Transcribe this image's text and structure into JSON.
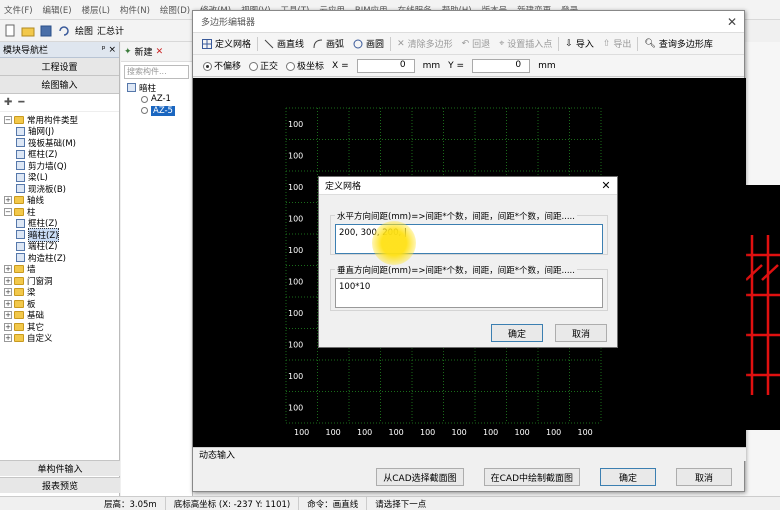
{
  "app": {
    "menu": [
      "文件(F)",
      "编辑(E)",
      "楼层(L)",
      "构件(N)",
      "绘图(D)",
      "修改(M)",
      "视图(V)",
      "工具(T)",
      "云应用",
      "BIM应用",
      "在线服务",
      "帮助(H)",
      "版本号",
      "新建变更",
      "登录"
    ],
    "toolbar": {
      "draw": "绘图",
      "summary": "汇总计"
    }
  },
  "left_panel": {
    "title": "模块导航栏",
    "pin": "ᵖ ×",
    "project_settings": "工程设置",
    "drawing_input": "绘图输入",
    "tree": [
      {
        "label": "常用构件类型",
        "level": 0,
        "type": "folder",
        "exp": "−"
      },
      {
        "label": "轴网(J)",
        "level": 1,
        "type": "leaf"
      },
      {
        "label": "筏板基础(M)",
        "level": 1,
        "type": "leaf"
      },
      {
        "label": "框柱(Z)",
        "level": 1,
        "type": "leaf"
      },
      {
        "label": "剪力墙(Q)",
        "level": 1,
        "type": "leaf"
      },
      {
        "label": "梁(L)",
        "level": 1,
        "type": "leaf"
      },
      {
        "label": "现浇板(B)",
        "level": 1,
        "type": "leaf"
      },
      {
        "label": "轴线",
        "level": 0,
        "type": "folder",
        "exp": "+"
      },
      {
        "label": "柱",
        "level": 0,
        "type": "folder",
        "exp": "−"
      },
      {
        "label": "框柱(Z)",
        "level": 1,
        "type": "leaf"
      },
      {
        "label": "暗柱(Z)",
        "level": 1,
        "type": "leaf",
        "selected": true
      },
      {
        "label": "端柱(Z)",
        "level": 1,
        "type": "leaf"
      },
      {
        "label": "构造柱(Z)",
        "level": 1,
        "type": "leaf"
      },
      {
        "label": "墙",
        "level": 0,
        "type": "folder",
        "exp": "+"
      },
      {
        "label": "门窗洞",
        "level": 0,
        "type": "folder",
        "exp": "+"
      },
      {
        "label": "梁",
        "level": 0,
        "type": "folder",
        "exp": "+"
      },
      {
        "label": "板",
        "level": 0,
        "type": "folder",
        "exp": "+"
      },
      {
        "label": "基础",
        "level": 0,
        "type": "folder",
        "exp": "+"
      },
      {
        "label": "其它",
        "level": 0,
        "type": "folder",
        "exp": "+"
      },
      {
        "label": "自定义",
        "level": 0,
        "type": "folder",
        "exp": "+"
      }
    ],
    "single_input": "单构件输入",
    "report_preview": "报表预览"
  },
  "component_panel": {
    "new": "新建",
    "search_placeholder": "搜索构件...",
    "root": "暗柱",
    "items": [
      "AZ-1",
      "AZ-5"
    ]
  },
  "status": {
    "floor_height": "层高：3.05m",
    "base_elev": "底标高坐标 (X: -237 Y: 1101)",
    "command": "命令：画直线",
    "prompt": "请选择下一点"
  },
  "poly_editor": {
    "title": "多边形编辑器",
    "toolbar": {
      "define_grid": "定义网格",
      "line": "画直线",
      "arc": "画弧",
      "circle": "画圆",
      "clear": "清除多边形",
      "undo": "回退",
      "insert_point": "设置插入点",
      "import": "导入",
      "export": "导出",
      "query": "查询多边形库"
    },
    "options": {
      "no_offset": "不偏移",
      "ortho": "正交",
      "polar": "极坐标",
      "x_label": "X =",
      "x_value": "0",
      "y_label": "Y =",
      "y_value": "0",
      "unit": "mm"
    },
    "grid_labels_left": [
      "100",
      "100",
      "100",
      "100",
      "100",
      "100",
      "100",
      "100",
      "100",
      "100"
    ],
    "grid_labels_bottom": [
      "100",
      "100",
      "100",
      "100",
      "100",
      "100",
      "100",
      "100",
      "100",
      "100"
    ],
    "dynamic_input": "动态输入",
    "buttons": {
      "from_cad": "从CAD选择截面图",
      "draw_in_cad": "在CAD中绘制截面图",
      "ok": "确定",
      "cancel": "取消"
    }
  },
  "grid_dialog": {
    "title": "定义网格",
    "h_label": "水平方向间距(mm)=>间距*个数，间距，间距*个数，间距.....",
    "h_value": "200, 300, 200, |",
    "v_label": "垂直方向间距(mm)=>间距*个数，间距，间距*个数，间距.....",
    "v_value": "100*10",
    "ok": "确定",
    "cancel": "取消"
  },
  "colors": {
    "accent": "#3c7fb1",
    "grid_line": "#1a6b1a",
    "cad_red": "#e01010"
  }
}
